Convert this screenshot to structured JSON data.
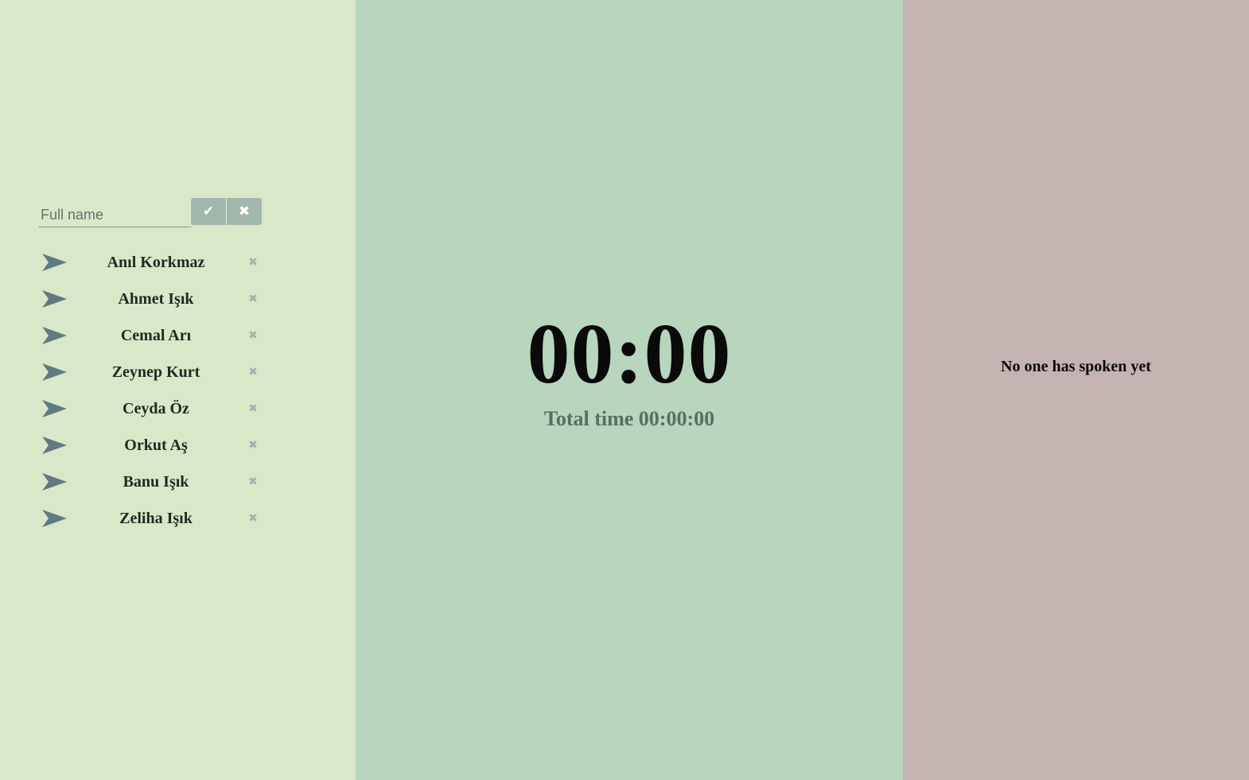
{
  "add_form": {
    "placeholder": "Full name",
    "confirm_label": "✔",
    "cancel_label": "✖"
  },
  "people": [
    {
      "name": "Anıl Korkmaz"
    },
    {
      "name": "Ahmet Işık"
    },
    {
      "name": "Cemal Arı"
    },
    {
      "name": "Zeynep Kurt"
    },
    {
      "name": "Ceyda Öz"
    },
    {
      "name": "Orkut Aş"
    },
    {
      "name": "Banu Işık"
    },
    {
      "name": "Zeliha Işık"
    }
  ],
  "person_row_icons": {
    "select": "arrow-right-icon",
    "remove": "close-icon",
    "remove_glyph": "✖"
  },
  "timer": {
    "current": "00:00",
    "total_label": "Total time",
    "total_value": "00:00:00"
  },
  "history": {
    "empty_text": "No one has spoken yet"
  },
  "colors": {
    "left_panel": "#d9e8c9",
    "middle_panel": "#b7d6bd",
    "right_panel": "#c4b4b1",
    "button": "#a3b8ad",
    "arrow": "#617a80"
  }
}
